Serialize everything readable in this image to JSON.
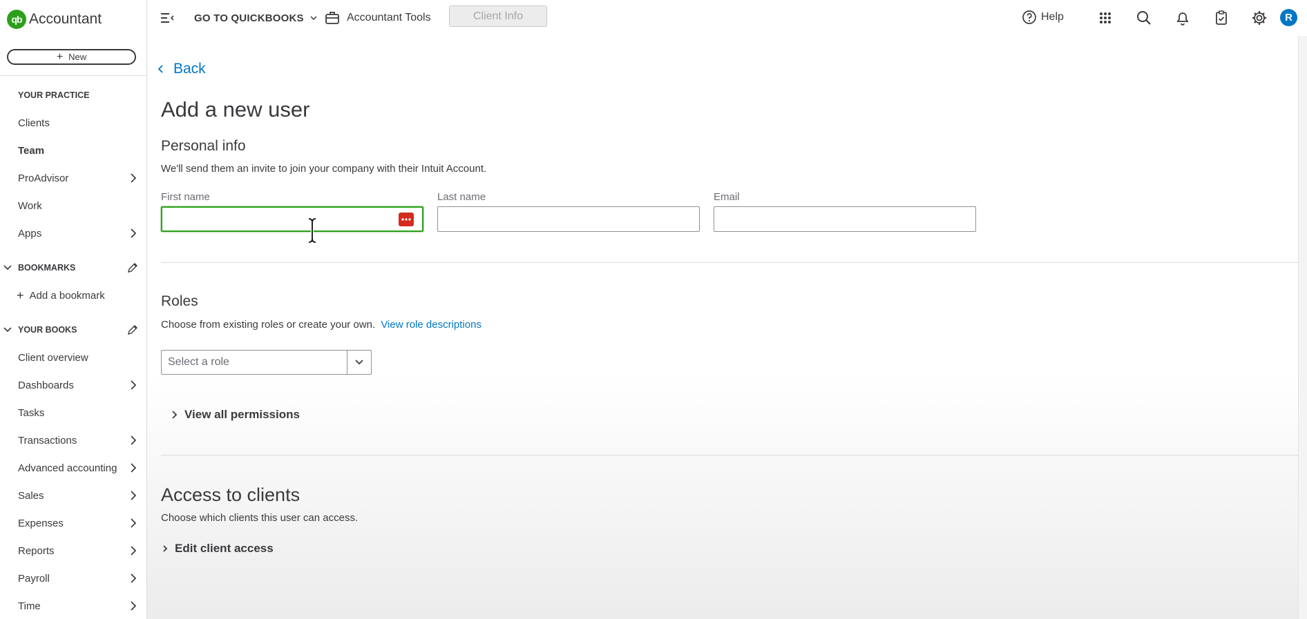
{
  "sidebar": {
    "logo_text": "Accountant",
    "new_button": "New",
    "practice_header": "YOUR PRACTICE",
    "practice_items": [
      {
        "label": "Clients",
        "has_chevron": false
      },
      {
        "label": "Team",
        "has_chevron": false,
        "active": true
      },
      {
        "label": "ProAdvisor",
        "has_chevron": true
      },
      {
        "label": "Work",
        "has_chevron": false
      },
      {
        "label": "Apps",
        "has_chevron": true
      }
    ],
    "bookmarks_header": "BOOKMARKS",
    "add_bookmark": "Add a bookmark",
    "books_header": "YOUR BOOKS",
    "books_items": [
      {
        "label": "Client overview",
        "has_chevron": false
      },
      {
        "label": "Dashboards",
        "has_chevron": true
      },
      {
        "label": "Tasks",
        "has_chevron": false
      },
      {
        "label": "Transactions",
        "has_chevron": true
      },
      {
        "label": "Advanced accounting",
        "has_chevron": true
      },
      {
        "label": "Sales",
        "has_chevron": true
      },
      {
        "label": "Expenses",
        "has_chevron": true
      },
      {
        "label": "Reports",
        "has_chevron": true
      },
      {
        "label": "Payroll",
        "has_chevron": true
      },
      {
        "label": "Time",
        "has_chevron": true
      }
    ]
  },
  "topbar": {
    "goto_quickbooks": "GO TO QUICKBOOKS",
    "accountant_tools": "Accountant Tools",
    "client_info": "Client Info",
    "help": "Help",
    "avatar_initial": "R"
  },
  "main": {
    "back": "Back",
    "title": "Add a new user",
    "personal_info": {
      "heading": "Personal info",
      "description": "We'll send them an invite to join your company with their Intuit Account.",
      "first_name_label": "First name",
      "first_name_value": "",
      "last_name_label": "Last name",
      "last_name_value": "",
      "email_label": "Email",
      "email_value": ""
    },
    "roles": {
      "heading": "Roles",
      "description": "Choose from existing roles or create your own.",
      "link": "View role descriptions",
      "select_placeholder": "Select a role",
      "view_permissions": "View all permissions"
    },
    "access": {
      "heading": "Access to clients",
      "description": "Choose which clients this user can access.",
      "edit_access": "Edit client access"
    }
  },
  "colors": {
    "brand_green": "#2ca01c",
    "link_blue": "#0077c5",
    "text": "#393a3d",
    "password_manager_red": "#d52b1e"
  }
}
